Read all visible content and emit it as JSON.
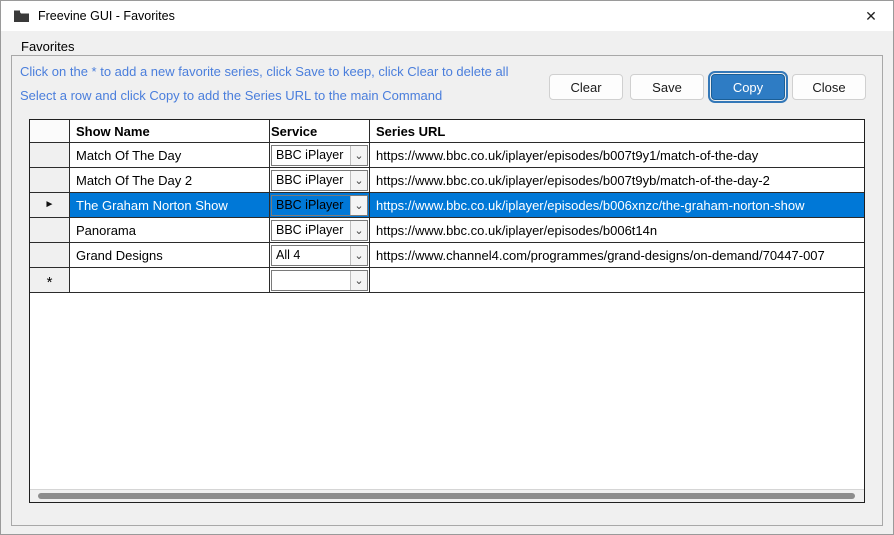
{
  "window": {
    "title": "Freevine GUI - Favorites",
    "close_glyph": "✕"
  },
  "groupbox": {
    "label": "Favorites"
  },
  "instructions": {
    "line1": "Click on the * to add a new favorite series, click Save to keep, click Clear to delete all",
    "line2": "Select a row and click Copy to add the Series URL to the main Command"
  },
  "buttons": {
    "clear": "Clear",
    "save": "Save",
    "copy": "Copy",
    "close": "Close"
  },
  "grid": {
    "columns": [
      "Show Name",
      "Service",
      "Series URL"
    ],
    "selected_row_index": 2,
    "markers": {
      "current_row": "►",
      "new_row": "*",
      "dropdown": "⌄"
    },
    "rows": [
      {
        "show": "Match Of The Day",
        "service": "BBC iPlayer",
        "url": "https://www.bbc.co.uk/iplayer/episodes/b007t9y1/match-of-the-day"
      },
      {
        "show": "Match Of The Day 2",
        "service": "BBC iPlayer",
        "url": "https://www.bbc.co.uk/iplayer/episodes/b007t9yb/match-of-the-day-2"
      },
      {
        "show": "The Graham Norton Show",
        "service": "BBC iPlayer",
        "url": "https://www.bbc.co.uk/iplayer/episodes/b006xnzc/the-graham-norton-show"
      },
      {
        "show": "Panorama",
        "service": "BBC iPlayer",
        "url": "https://www.bbc.co.uk/iplayer/episodes/b006t14n"
      },
      {
        "show": "Grand Designs",
        "service": "All 4",
        "url": "https://www.channel4.com/programmes/grand-designs/on-demand/70447-007"
      }
    ]
  },
  "colors": {
    "selection_bg": "#0078d7",
    "selection_fg": "#ffffff",
    "instruction_text": "#4a7edc",
    "accent_button_bg": "#2e7cc4"
  }
}
